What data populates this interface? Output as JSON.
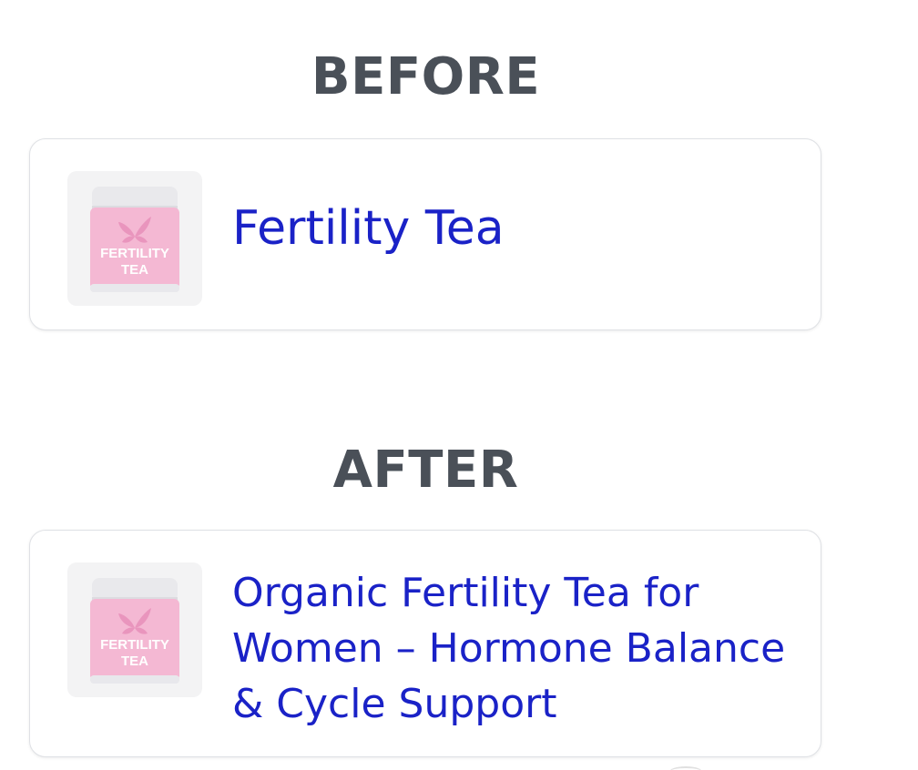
{
  "sections": {
    "before": {
      "heading": "BEFORE",
      "product": {
        "title": "Fertility Tea",
        "image_label_line1": "FERTILITY",
        "image_label_line2": "TEA"
      }
    },
    "after": {
      "heading": "AFTER",
      "product": {
        "title": "Organic Fertility Tea for Women – Hormone Balance & Cycle Support",
        "image_label_line1": "FERTILITY",
        "image_label_line2": "TEA"
      }
    }
  },
  "colors": {
    "heading": "#4a5058",
    "title_link": "#1a22c7",
    "jar_body": "#f4b8d3",
    "jar_lid": "#e9e9ec",
    "leaf": "#e995bd"
  },
  "icons": {
    "product_image": "fertility-tea-jar"
  }
}
